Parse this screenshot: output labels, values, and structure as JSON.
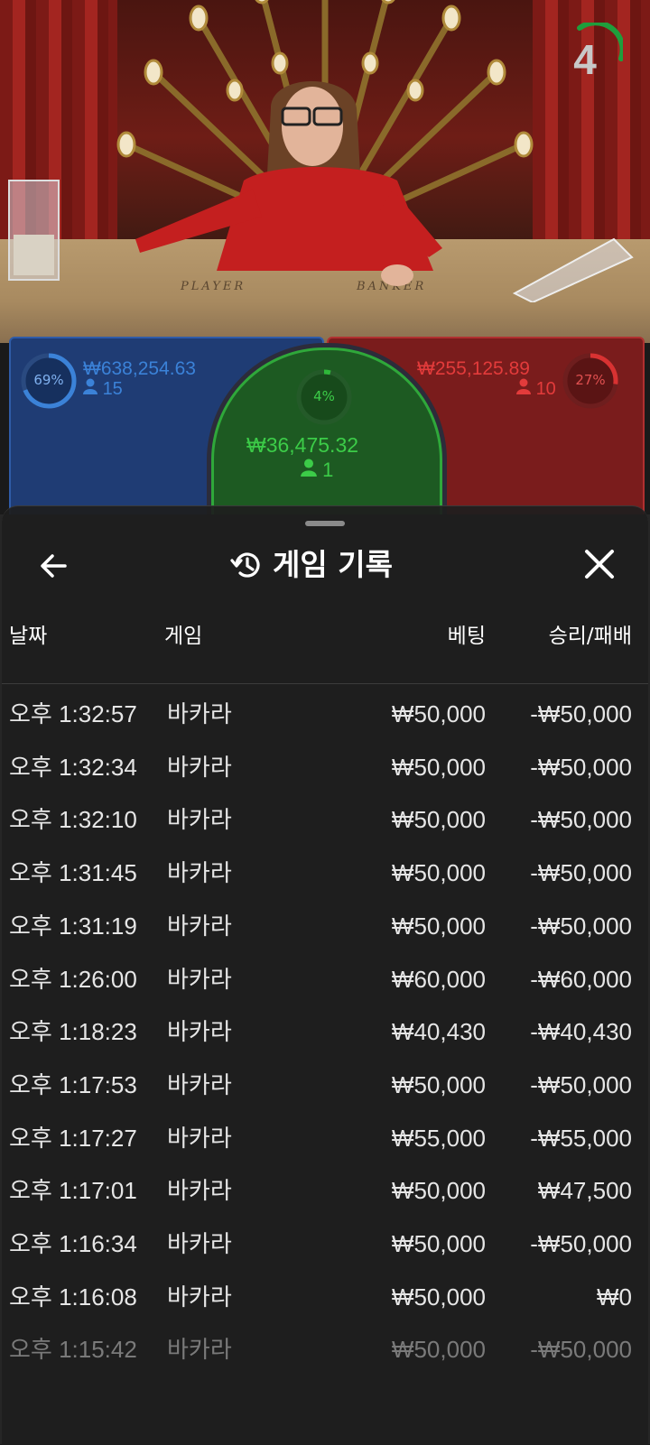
{
  "video": {
    "felt_player": "PLAYER",
    "felt_banker": "BANKER",
    "countdown": "4"
  },
  "bets": {
    "player": {
      "percent": "69%",
      "amount": "₩638,254.63",
      "players": "15",
      "color": "#3b82d8"
    },
    "banker": {
      "percent": "27%",
      "amount": "₩255,125.89",
      "players": "10",
      "color": "#d83232"
    },
    "tie": {
      "percent": "4%",
      "amount": "₩36,475.32",
      "players": "1",
      "color": "#2fb83a"
    }
  },
  "sheet": {
    "title": "게임 기록",
    "columns": {
      "date": "날짜",
      "game": "게임",
      "bet": "베팅",
      "result": "승리/패배"
    },
    "rows": [
      {
        "time": "오후 1:32:57",
        "game": "바카라",
        "bet": "₩50,000",
        "result": "-₩50,000"
      },
      {
        "time": "오후 1:32:34",
        "game": "바카라",
        "bet": "₩50,000",
        "result": "-₩50,000"
      },
      {
        "time": "오후 1:32:10",
        "game": "바카라",
        "bet": "₩50,000",
        "result": "-₩50,000"
      },
      {
        "time": "오후 1:31:45",
        "game": "바카라",
        "bet": "₩50,000",
        "result": "-₩50,000"
      },
      {
        "time": "오후 1:31:19",
        "game": "바카라",
        "bet": "₩50,000",
        "result": "-₩50,000"
      },
      {
        "time": "오후 1:26:00",
        "game": "바카라",
        "bet": "₩60,000",
        "result": "-₩60,000"
      },
      {
        "time": "오후 1:18:23",
        "game": "바카라",
        "bet": "₩40,430",
        "result": "-₩40,430"
      },
      {
        "time": "오후 1:17:53",
        "game": "바카라",
        "bet": "₩50,000",
        "result": "-₩50,000"
      },
      {
        "time": "오후 1:17:27",
        "game": "바카라",
        "bet": "₩55,000",
        "result": "-₩55,000"
      },
      {
        "time": "오후 1:17:01",
        "game": "바카라",
        "bet": "₩50,000",
        "result": "₩47,500"
      },
      {
        "time": "오후 1:16:34",
        "game": "바카라",
        "bet": "₩50,000",
        "result": "-₩50,000"
      },
      {
        "time": "오후 1:16:08",
        "game": "바카라",
        "bet": "₩50,000",
        "result": "₩0"
      },
      {
        "time": "오후 1:15:42",
        "game": "바카라",
        "bet": "₩50,000",
        "result": "-₩50,000"
      }
    ]
  }
}
